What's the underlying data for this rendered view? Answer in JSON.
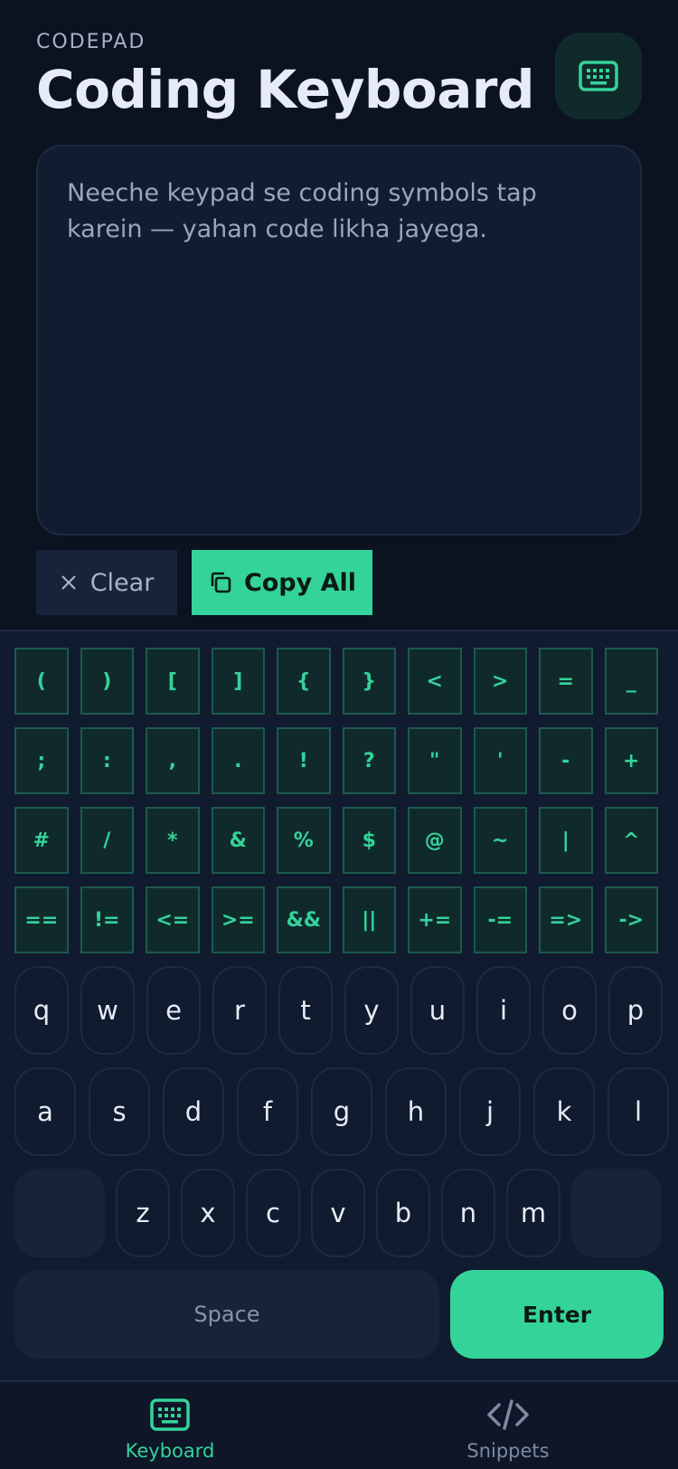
{
  "header": {
    "brand": "CODEPAD",
    "title": "Coding Keyboard",
    "icon": "keyboard-icon"
  },
  "editor": {
    "placeholder": "Neeche keypad se coding symbols tap karein — yahan code likha jayega."
  },
  "actions": {
    "clear_label": "Clear",
    "copy_label": "Copy All"
  },
  "symbols": {
    "row1": [
      "(",
      ")",
      "[",
      "]",
      "{",
      "}",
      "<",
      ">",
      "=",
      "_"
    ],
    "row2": [
      ";",
      ":",
      ",",
      ".",
      "!",
      "?",
      "\"",
      "'",
      "-",
      "+"
    ],
    "row3": [
      "#",
      "/",
      "*",
      "&",
      "%",
      "$",
      "@",
      "~",
      "|",
      "^"
    ],
    "row4": [
      "==",
      "!=",
      "<=",
      ">=",
      "&&",
      "||",
      "+=",
      "-=",
      "=>",
      "->"
    ]
  },
  "letters": {
    "row1": [
      "q",
      "w",
      "e",
      "r",
      "t",
      "y",
      "u",
      "i",
      "o",
      "p"
    ],
    "row2": [
      "a",
      "s",
      "d",
      "f",
      "g",
      "h",
      "j",
      "k",
      "l"
    ],
    "row3": [
      "z",
      "x",
      "c",
      "v",
      "b",
      "n",
      "m"
    ]
  },
  "keys": {
    "space": "Space",
    "enter": "Enter"
  },
  "nav": {
    "keyboard": "Keyboard",
    "snippets": "Snippets",
    "active": "keyboard"
  },
  "colors": {
    "accent": "#34d399",
    "background": "#0b1220",
    "panel": "#111b2f"
  }
}
